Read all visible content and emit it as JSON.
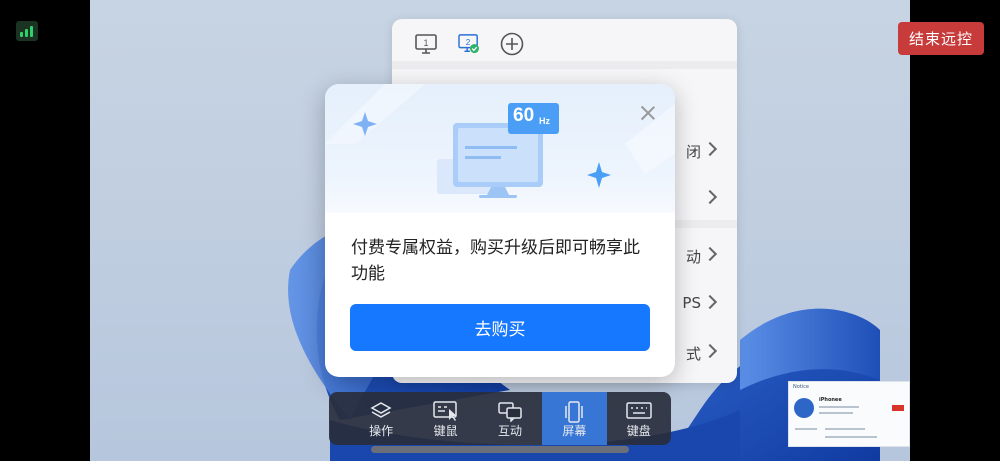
{
  "top_bar": {
    "end_button_label": "结束远控"
  },
  "panel": {
    "rows": [
      {
        "label": "闭"
      },
      {
        "label": ""
      },
      {
        "label": "动"
      },
      {
        "label": "PS"
      },
      {
        "label": "式"
      }
    ]
  },
  "modal": {
    "hz_number": "60",
    "hz_unit": "Hz",
    "message": "付费专属权益，购买升级后即可畅享此功能",
    "buy_button_label": "去购买"
  },
  "toolbar": {
    "items": [
      {
        "label": "操作",
        "icon": "layers-icon",
        "active": false
      },
      {
        "label": "键鼠",
        "icon": "keyboard-mouse-icon",
        "active": false
      },
      {
        "label": "互动",
        "icon": "chat-icon",
        "active": false
      },
      {
        "label": "屏幕",
        "icon": "screen-icon",
        "active": true
      },
      {
        "label": "键盘",
        "icon": "keyboard-icon",
        "active": false
      }
    ]
  },
  "notification": {
    "header": "Notice",
    "name": "iPhonee"
  },
  "colors": {
    "accent": "#1677ff",
    "end_button": "#c73b3a",
    "toolbar_active": "#3876d6",
    "hz_badge": "#4a9ef5"
  }
}
